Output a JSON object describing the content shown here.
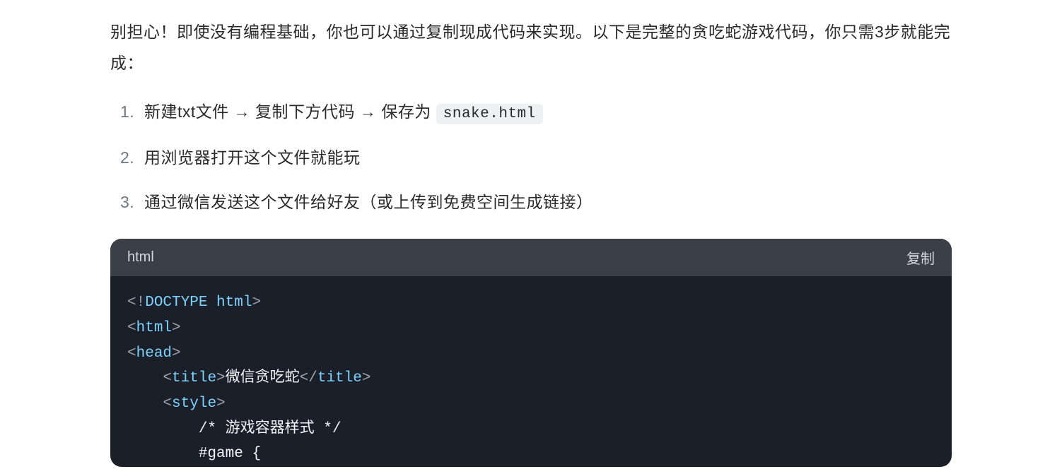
{
  "intro": "别担心！即使没有编程基础，你也可以通过复制现成代码来实现。以下是完整的贪吃蛇游戏代码，你只需3步就能完成：",
  "steps": {
    "item1_prefix": "新建txt文件 → 复制下方代码 → 保存为 ",
    "item1_code": "snake.html",
    "item2": "用浏览器打开这个文件就能玩",
    "item3": "通过微信发送这个文件给好友（或上传到免费空间生成链接）"
  },
  "codeblock": {
    "language": "html",
    "copy_label": "复制",
    "lines": {
      "l1_a": "<!",
      "l1_b": "DOCTYPE html",
      "l1_c": ">",
      "l2_a": "<",
      "l2_b": "html",
      "l2_c": ">",
      "l3_a": "<",
      "l3_b": "head",
      "l3_c": ">",
      "l4_indent": "    ",
      "l4_a": "<",
      "l4_b": "title",
      "l4_c": ">",
      "l4_text": "微信贪吃蛇",
      "l4_d": "</",
      "l4_e": "title",
      "l4_f": ">",
      "l5_indent": "    ",
      "l5_a": "<",
      "l5_b": "style",
      "l5_c": ">",
      "l6_indent": "        ",
      "l6_comment": "/* 游戏容器样式 */",
      "l7_indent": "        ",
      "l7_sel": "#game {"
    }
  }
}
